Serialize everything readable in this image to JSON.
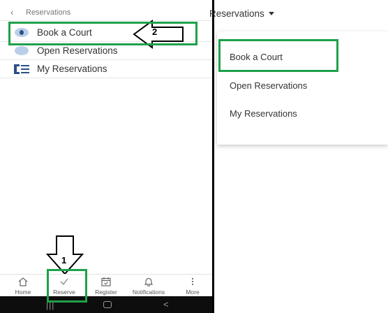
{
  "mobile": {
    "header": {
      "back_icon": "chevron-left-icon",
      "title": "Reservations"
    },
    "menu": [
      {
        "label": "Book a Court",
        "icon": "selected-circle-icon"
      },
      {
        "label": "Open Reservations",
        "icon": "circle-icon"
      },
      {
        "label": "My Reservations",
        "icon": "list-icon"
      }
    ],
    "bottom_nav": [
      {
        "label": "Home",
        "icon": "home-icon"
      },
      {
        "label": "Reserve",
        "icon": "check-icon"
      },
      {
        "label": "Register",
        "icon": "calendar-icon"
      },
      {
        "label": "Notifications",
        "icon": "bell-icon"
      },
      {
        "label": "More",
        "icon": "more-vertical-icon"
      }
    ],
    "system_nav": {
      "recents_glyph": "|||",
      "back_glyph": "<"
    }
  },
  "annotations": {
    "step1": "1",
    "step2": "2",
    "highlight_color": "#1ea14a"
  },
  "web": {
    "dropdown_trigger": "Reservations",
    "items": [
      {
        "label": "Book a Court"
      },
      {
        "label": "Open Reservations"
      },
      {
        "label": "My Reservations"
      }
    ]
  },
  "colors": {
    "accent_blue": "#2c4f87",
    "light_blue": "#b9cfe8",
    "highlight_green": "#1ea14a"
  }
}
